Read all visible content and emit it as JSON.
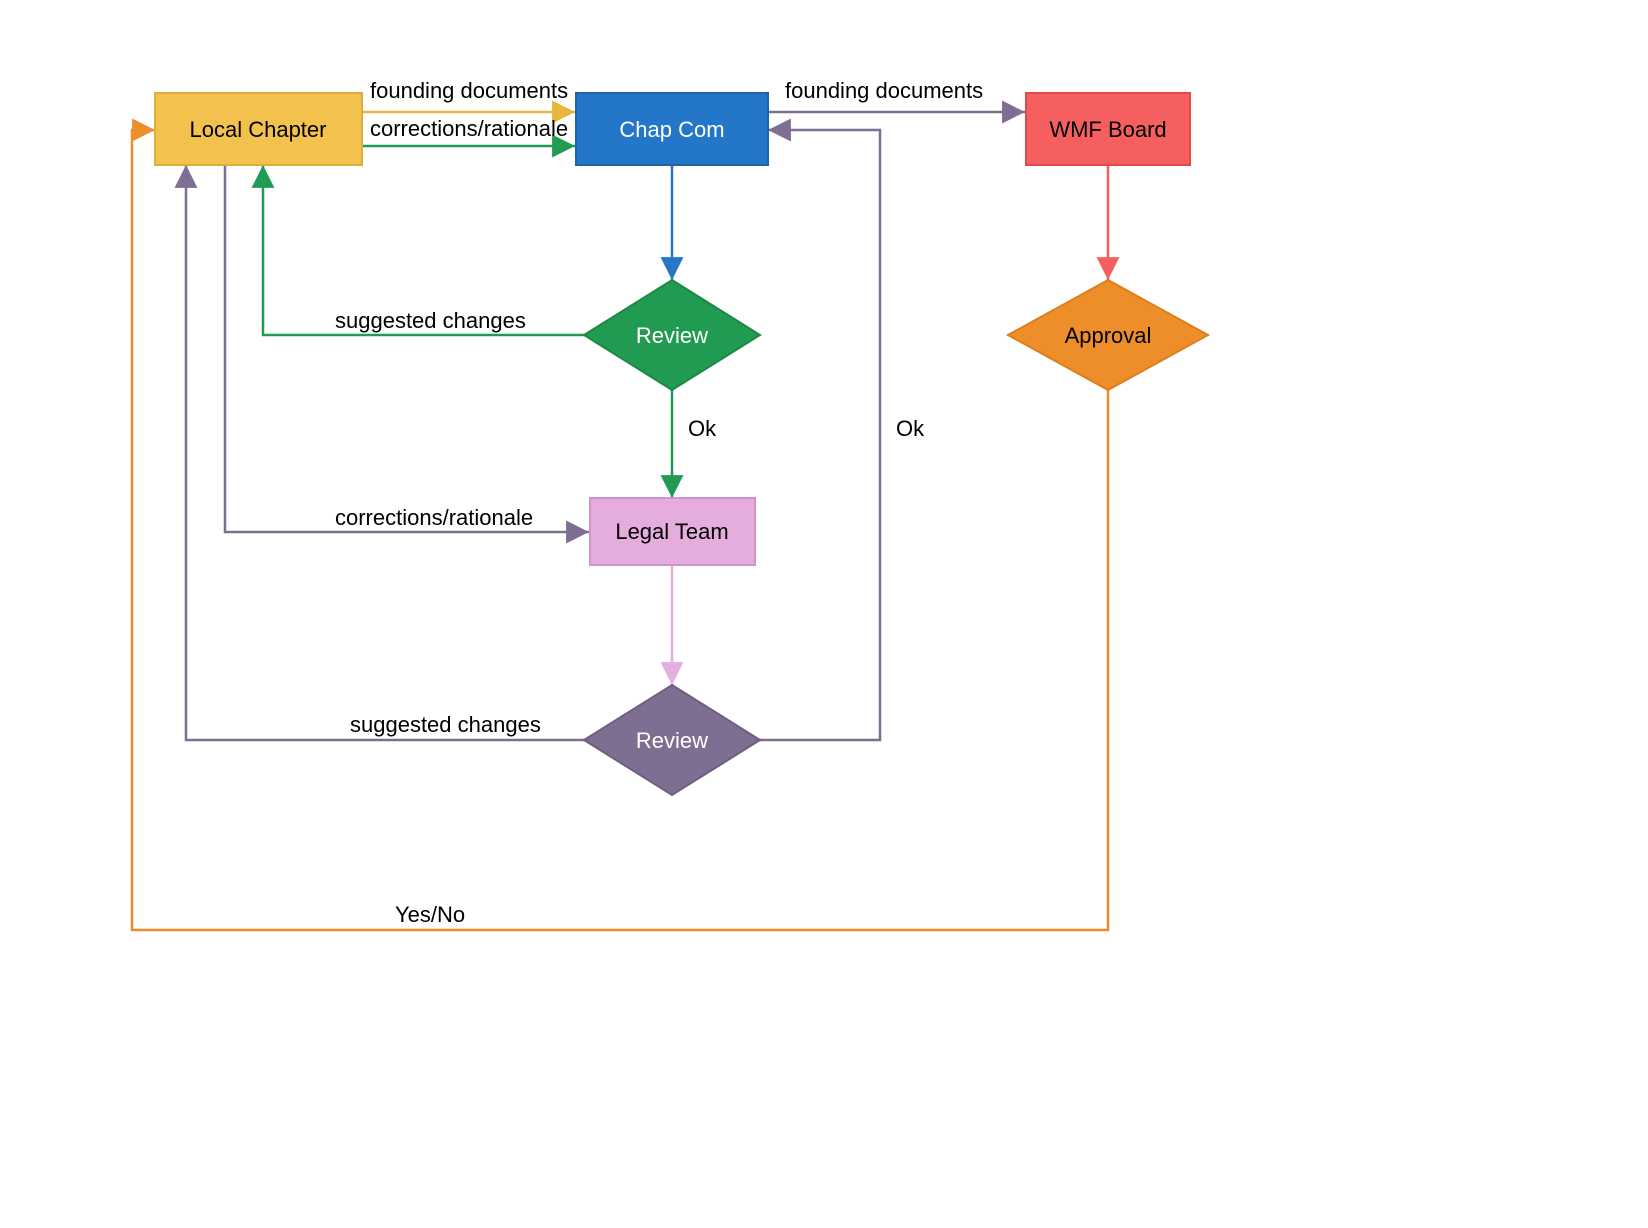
{
  "nodes": {
    "local_chapter": {
      "label": "Local Chapter"
    },
    "chap_com": {
      "label": "Chap Com"
    },
    "wmf_board": {
      "label": "WMF Board"
    },
    "review1": {
      "label": "Review"
    },
    "legal_team": {
      "label": "Legal Team"
    },
    "review2": {
      "label": "Review"
    },
    "approval": {
      "label": "Approval"
    }
  },
  "edges": {
    "lc_to_cc_founding": {
      "label": "founding documents"
    },
    "lc_to_cc_corrections": {
      "label": "corrections/rationale"
    },
    "cc_to_wmf": {
      "label": "founding documents"
    },
    "review1_to_lc": {
      "label": "suggested changes"
    },
    "review1_to_legal": {
      "label": "Ok"
    },
    "lc_to_legal": {
      "label": "corrections/rationale"
    },
    "review2_to_lc": {
      "label": "suggested changes"
    },
    "review2_to_cc": {
      "label": "Ok"
    },
    "approval_to_lc": {
      "label": "Yes/No"
    }
  },
  "colors": {
    "local_chapter_fill": "#F3C24E",
    "local_chapter_stroke": "#DDAE3B",
    "chap_com_fill": "#2477C8",
    "chap_com_stroke": "#1E63A8",
    "wmf_board_fill": "#F55F60",
    "wmf_board_stroke": "#E54A4B",
    "review1_fill": "#229B52",
    "review1_stroke": "#1D8747",
    "legal_team_fill": "#E5ADDE",
    "legal_team_stroke": "#D492CC",
    "review2_fill": "#7E6E92",
    "review2_stroke": "#6E5F81",
    "approval_fill": "#EE8E2B",
    "approval_stroke": "#DC7E1D",
    "edge_yellow": "#E7B63A",
    "edge_green": "#229B52",
    "edge_blue": "#2477C8",
    "edge_purple": "#7E6E92",
    "edge_pink": "#E5ADDE",
    "edge_salmon": "#F55F60",
    "edge_orange": "#EE8E2B"
  }
}
